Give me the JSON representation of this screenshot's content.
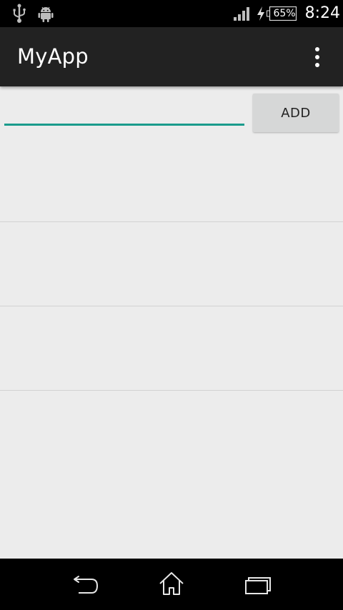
{
  "status_bar": {
    "battery_percent": "65%",
    "time": "8:24",
    "icons": [
      "usb-icon",
      "android-icon",
      "cell-signal-icon",
      "charging-icon",
      "battery-icon"
    ]
  },
  "app_bar": {
    "title": "MyApp",
    "menu_icon": "overflow-menu-icon"
  },
  "input": {
    "value": "",
    "placeholder": "",
    "accent_color": "#1a9b8c"
  },
  "add_button": {
    "label": "ADD"
  },
  "list": {
    "items": [
      {
        "text": ""
      },
      {
        "text": ""
      },
      {
        "text": ""
      }
    ]
  },
  "nav_bar": {
    "icons": [
      "back-icon",
      "home-icon",
      "recent-apps-icon"
    ]
  },
  "colors": {
    "status_bar_bg": "#000000",
    "app_bar_bg": "#222222",
    "content_bg": "#ececec",
    "button_bg": "#d6d7d7",
    "divider": "#d2d2d2"
  }
}
